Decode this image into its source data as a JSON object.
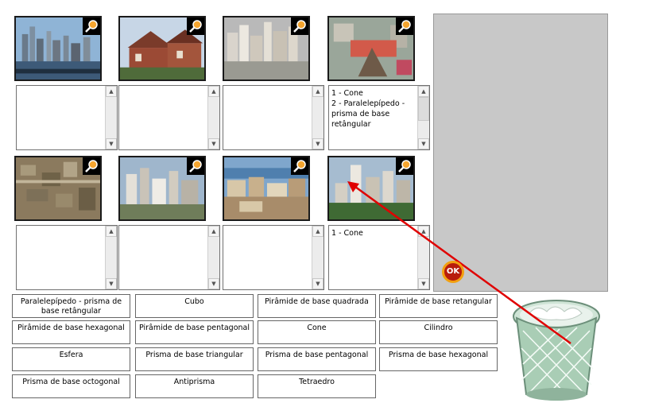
{
  "photos": [
    {
      "name": "city-photo-1",
      "zoom_icon": "magnifier-icon"
    },
    {
      "name": "city-photo-2",
      "zoom_icon": "magnifier-icon"
    },
    {
      "name": "city-photo-3",
      "zoom_icon": "magnifier-icon"
    },
    {
      "name": "city-photo-4",
      "zoom_icon": "magnifier-icon"
    },
    {
      "name": "city-photo-5",
      "zoom_icon": "magnifier-icon"
    },
    {
      "name": "city-photo-6",
      "zoom_icon": "magnifier-icon"
    },
    {
      "name": "city-photo-7",
      "zoom_icon": "magnifier-icon"
    },
    {
      "name": "city-photo-8",
      "zoom_icon": "magnifier-icon"
    }
  ],
  "answer_boxes": [
    {
      "text": ""
    },
    {
      "text": ""
    },
    {
      "text": ""
    },
    {
      "text": "1 - Cone\n2 - Paralelepípedo - prisma de base retângular"
    },
    {
      "text": ""
    },
    {
      "text": ""
    },
    {
      "text": ""
    },
    {
      "text": "1 - Cone"
    }
  ],
  "options": [
    "Paralelepípedo - prisma de base retângular",
    "Cubo",
    "Pirâmide de base quadrada",
    "Pirâmide de base retangular",
    "Pirâmide de base hexagonal",
    "Pirâmide de base pentagonal",
    "Cone",
    "Cilindro",
    "Esfera",
    "Prisma de base triangular",
    "Prisma de base pentagonal",
    "Prisma de base hexagonal",
    "Prisma de base octogonal",
    "Antiprisma",
    "Tetraedro"
  ],
  "ok_button": {
    "label": "OK"
  },
  "trash": {
    "icon": "trash-bin-icon"
  },
  "colors": {
    "arrow": "#e00000",
    "ok_fill": "#b81c0c",
    "ok_ring": "#f2a010",
    "drop_area": "#c8c8c8"
  }
}
